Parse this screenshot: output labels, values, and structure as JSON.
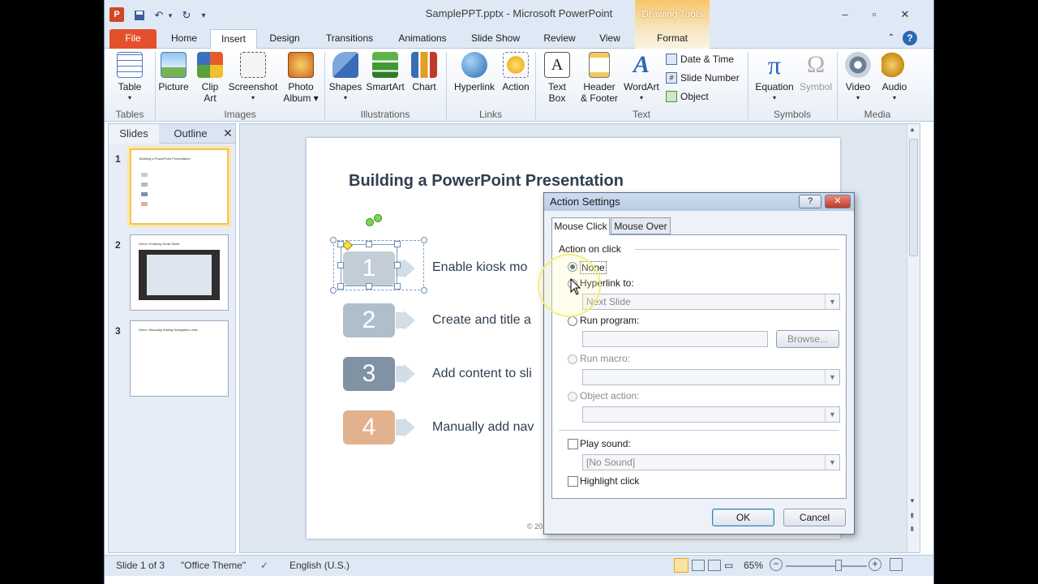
{
  "window": {
    "title": "SamplePPT.pptx - Microsoft PowerPoint",
    "app_icon": "P",
    "contextual_tab_group": "Drawing Tools",
    "controls": [
      "minimize-icon",
      "maximize-icon",
      "close-icon"
    ]
  },
  "qat": {
    "save_icon": "save-icon",
    "undo_icon": "undo-icon",
    "redo_icon": "redo-icon"
  },
  "tabs": [
    "File",
    "Home",
    "Insert",
    "Design",
    "Transitions",
    "Animations",
    "Slide Show",
    "Review",
    "View",
    "Format"
  ],
  "ribbon": {
    "groups": {
      "tables": "Tables",
      "images": "Images",
      "illustrations": "Illustrations",
      "links": "Links",
      "text": "Text",
      "symbols": "Symbols",
      "media": "Media"
    },
    "buttons": {
      "table": "Table",
      "picture": "Picture",
      "clip_art_1": "Clip",
      "clip_art_2": "Art",
      "screenshot": "Screenshot",
      "photo_album_1": "Photo",
      "photo_album_2": "Album ▾",
      "shapes": "Shapes",
      "smartart": "SmartArt",
      "chart": "Chart",
      "hyperlink": "Hyperlink",
      "action": "Action",
      "text_box_1": "Text",
      "text_box_2": "Box",
      "header_footer_1": "Header",
      "header_footer_2": "& Footer",
      "wordart": "WordArt",
      "date_time": "Date & Time",
      "slide_number": "Slide Number",
      "object": "Object",
      "equation": "Equation",
      "symbol": "Symbol",
      "video": "Video",
      "audio": "Audio"
    }
  },
  "panes": {
    "slides_tab": "Slides",
    "outline_tab": "Outline"
  },
  "thumbnails": [
    {
      "num": "1",
      "title": "Building a PowerPoint Presentation"
    },
    {
      "num": "2",
      "title": "Demo: Enabling Kiosk Mode"
    },
    {
      "num": "3",
      "title": "Demo: Manually Adding Navigation Links"
    }
  ],
  "slide": {
    "title": "Building a PowerPoint Presentation",
    "steps": [
      {
        "num": "1",
        "text": "Enable kiosk mo",
        "color": "#c2cdd5"
      },
      {
        "num": "2",
        "text": "Create and title a",
        "color": "#aebfcb"
      },
      {
        "num": "3",
        "text": "Add content to sli",
        "color": "#7f93a4"
      },
      {
        "num": "4",
        "text": "Manually add nav",
        "color": "#e2b28f"
      }
    ],
    "footer": "© 20"
  },
  "dialog": {
    "title": "Action Settings",
    "help": "?",
    "tabs": [
      "Mouse Click",
      "Mouse Over"
    ],
    "section": "Action on click",
    "none": "None",
    "hyperlink": "Hyperlink to:",
    "hyperlink_value": "Next Slide",
    "run_program": "Run program:",
    "browse": "Browse...",
    "run_macro": "Run macro:",
    "object_action": "Object action:",
    "play_sound": "Play sound:",
    "sound_value": "[No Sound]",
    "highlight": "Highlight click",
    "ok": "OK",
    "cancel": "Cancel"
  },
  "status": {
    "slide_info": "Slide 1 of 3",
    "theme": "\"Office Theme\"",
    "language": "English (U.S.)",
    "zoom": "65%",
    "zoom_level": 0.65
  },
  "colors": {
    "file_tab": "#e4502b",
    "drawing_tools": "#f6c56a",
    "accent": "#27507a"
  }
}
